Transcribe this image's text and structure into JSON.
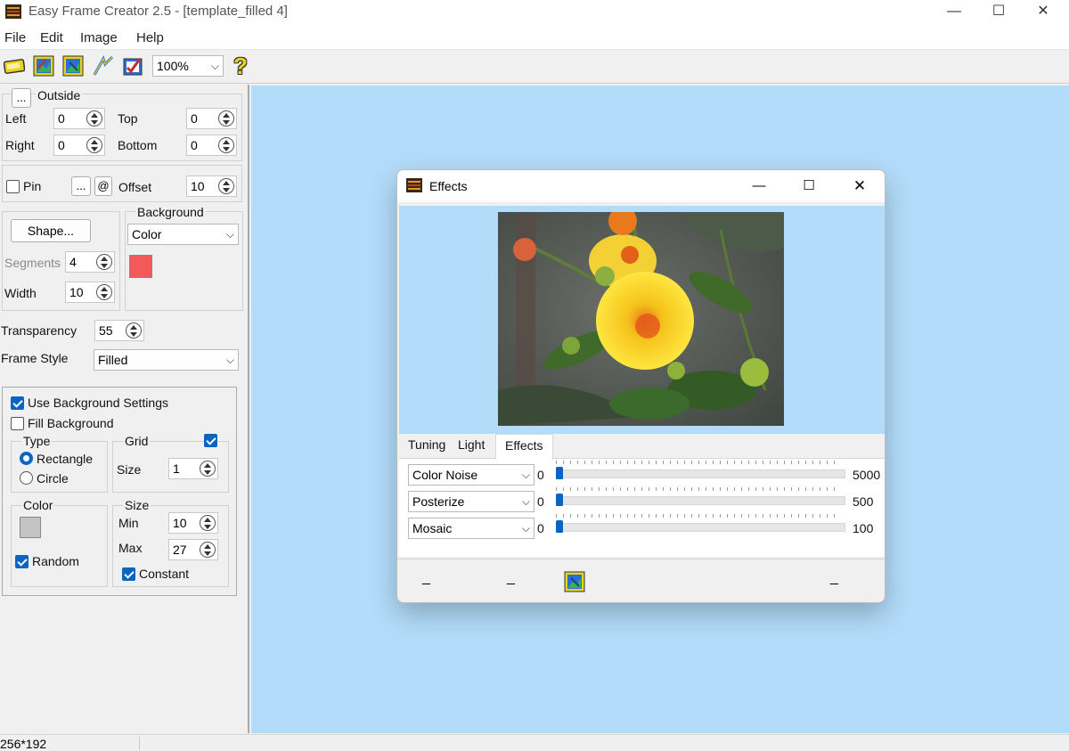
{
  "window": {
    "title": "Easy Frame Creator 2.5 - [template_filled 4]",
    "minimize_glyph": "—",
    "maximize_glyph": "☐",
    "close_glyph": "✕"
  },
  "menu": [
    "File",
    "Edit",
    "Image",
    "Help"
  ],
  "toolbar": {
    "icons": [
      "open-icon",
      "open-image-icon",
      "save-image-icon",
      "effects-wand-icon",
      "apply-frame-icon"
    ],
    "zoom": "100%",
    "help_glyph": "?"
  },
  "outside": {
    "button_label": "...",
    "label": "Outside",
    "left_label": "Left",
    "left_value": "0",
    "top_label": "Top",
    "top_value": "0",
    "right_label": "Right",
    "right_value": "0",
    "bottom_label": "Bottom",
    "bottom_value": "0"
  },
  "pin": {
    "label": "Pin",
    "checked": false,
    "dots_label": "...",
    "at_label": "@",
    "offset_label": "Offset",
    "offset_value": "10"
  },
  "shape": {
    "button_label": "Shape...",
    "segments_label": "Segments",
    "segments_value": "4",
    "width_label": "Width",
    "width_value": "10"
  },
  "background": {
    "label": "Background",
    "mode": "Color",
    "color": "#f25a5a"
  },
  "transparency": {
    "label": "Transparency",
    "value": "55"
  },
  "frame_style": {
    "label": "Frame Style",
    "value": "Filled"
  },
  "bg_settings": {
    "use_label": "Use Background Settings",
    "use_checked": true,
    "fill_label": "Fill Background",
    "fill_checked": false,
    "type_label": "Type",
    "rectangle_label": "Rectangle",
    "rectangle_selected": true,
    "circle_label": "Circle",
    "grid_label": "Grid",
    "grid_checked": true,
    "size_label": "Size",
    "size_value": "1",
    "color_label": "Color",
    "color_swatch": "#c4c4c4",
    "random_label": "Random",
    "random_checked": true,
    "size_group_label": "Size",
    "min_label": "Min",
    "min_value": "10",
    "max_label": "Max",
    "max_value": "27",
    "constant_label": "Constant",
    "constant_checked": true
  },
  "status": {
    "dimensions": "256*192"
  },
  "effects_dialog": {
    "title": "Effects",
    "minimize_glyph": "—",
    "maximize_glyph": "☐",
    "close_glyph": "✕",
    "tabs": [
      "Tuning",
      "Light",
      "Effects"
    ],
    "active_tab": "Effects",
    "rows": [
      {
        "effect": "Color Noise",
        "min": "0",
        "max": "5000",
        "value": 0
      },
      {
        "effect": "Posterize",
        "min": "0",
        "max": "500",
        "value": 0
      },
      {
        "effect": "Mosaic",
        "min": "0",
        "max": "100",
        "value": 0
      }
    ],
    "bottom_marks": [
      "_",
      "_",
      "_"
    ]
  }
}
